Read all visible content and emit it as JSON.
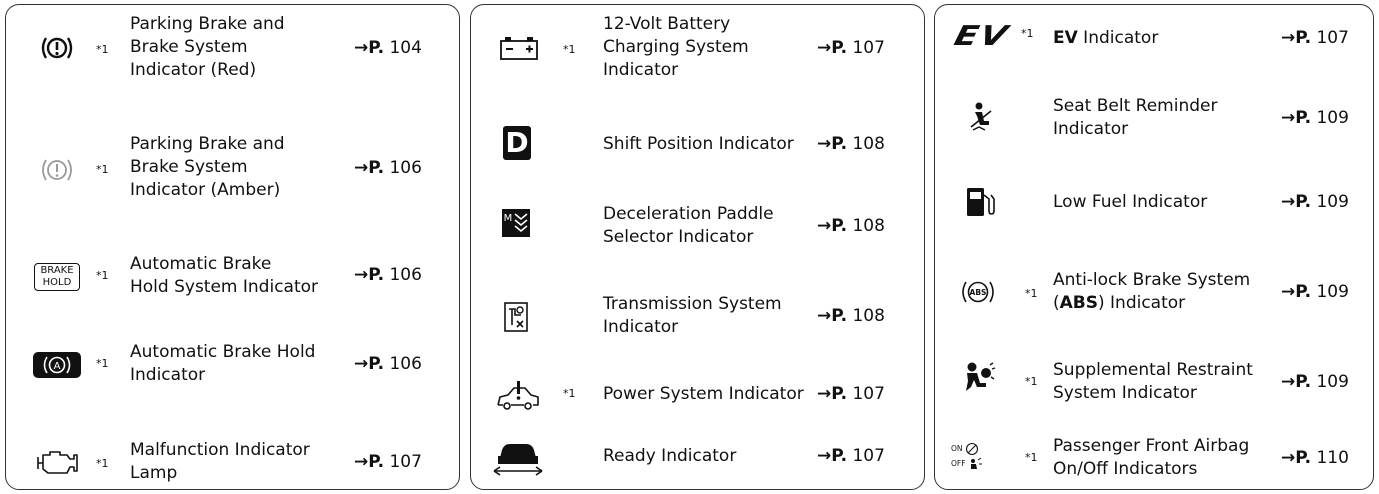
{
  "columns": [
    {
      "rows": [
        {
          "icon": "parking-brake-red-icon",
          "note": "*1",
          "label": "Parking Brake and\nBrake System\nIndicator (Red)",
          "ref_prefix": "→P.",
          "ref_page": "104"
        },
        {
          "icon": "parking-brake-amber-icon",
          "note": "*1",
          "label": "Parking Brake and\nBrake System\nIndicator (Amber)",
          "ref_prefix": "→P.",
          "ref_page": "106"
        },
        {
          "icon": "brake-hold-icon",
          "icon_text_top": "BRAKE",
          "icon_text_bottom": "HOLD",
          "note": "*1",
          "label": "Automatic Brake\nHold System Indicator",
          "ref_prefix": "→P.",
          "ref_page": "106"
        },
        {
          "icon": "auto-brake-hold-icon",
          "note": "*1",
          "label": "Automatic Brake Hold\nIndicator",
          "ref_prefix": "→P.",
          "ref_page": "106"
        },
        {
          "icon": "engine-malfunction-icon",
          "note": "*1",
          "label": "Malfunction Indicator\nLamp",
          "ref_prefix": "→P.",
          "ref_page": "107"
        }
      ]
    },
    {
      "rows": [
        {
          "icon": "battery-icon",
          "note": "*1",
          "label": "12-Volt Battery\nCharging System\nIndicator",
          "ref_prefix": "→P.",
          "ref_page": "107"
        },
        {
          "icon": "shift-position-icon",
          "icon_text": "D",
          "note": "",
          "label": "Shift Position Indicator",
          "ref_prefix": "→P.",
          "ref_page": "108"
        },
        {
          "icon": "deceleration-paddle-icon",
          "icon_text": "M",
          "note": "",
          "label": "Deceleration Paddle\nSelector Indicator",
          "ref_prefix": "→P.",
          "ref_page": "108"
        },
        {
          "icon": "transmission-system-icon",
          "note": "",
          "label": "Transmission System\nIndicator",
          "ref_prefix": "→P.",
          "ref_page": "108"
        },
        {
          "icon": "power-system-icon",
          "note": "*1",
          "label": "Power System Indicator",
          "ref_prefix": "→P.",
          "ref_page": "107"
        },
        {
          "icon": "ready-icon",
          "note": "",
          "label": "Ready Indicator",
          "ref_prefix": "→P.",
          "ref_page": "107"
        }
      ]
    },
    {
      "rows": [
        {
          "icon": "ev-icon",
          "icon_text": "EV",
          "note": "*1",
          "label_bold": "EV",
          "label": " Indicator",
          "ref_prefix": "→P.",
          "ref_page": "107"
        },
        {
          "icon": "seat-belt-icon",
          "note": "",
          "label": "Seat Belt Reminder\nIndicator",
          "ref_prefix": "→P.",
          "ref_page": "109"
        },
        {
          "icon": "low-fuel-icon",
          "note": "",
          "label": "Low Fuel Indicator",
          "ref_prefix": "→P.",
          "ref_page": "109"
        },
        {
          "icon": "abs-icon",
          "icon_text": "ABS",
          "note": "*1",
          "label_pre": "Anti-lock Brake System\n(",
          "label_bold": "ABS",
          "label": ") Indicator",
          "ref_prefix": "→P.",
          "ref_page": "109"
        },
        {
          "icon": "srs-airbag-icon",
          "note": "*1",
          "label": "Supplemental Restraint\nSystem Indicator",
          "ref_prefix": "→P.",
          "ref_page": "109"
        },
        {
          "icon": "passenger-airbag-icon",
          "icon_text_top": "ON",
          "icon_text_bottom": "OFF",
          "note": "*1",
          "label": "Passenger Front Airbag\nOn/Off Indicators",
          "ref_prefix": "→P.",
          "ref_page": "110"
        }
      ]
    }
  ]
}
